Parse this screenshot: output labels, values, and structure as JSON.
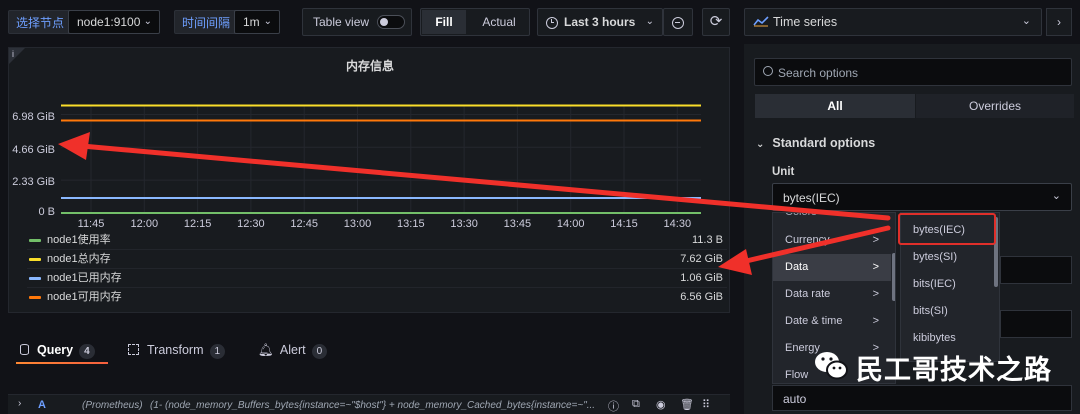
{
  "toolbar": {
    "node_label": "选择节点",
    "node_value": "node1:9100",
    "interval_label": "时间间隔",
    "interval_value": "1m",
    "table_view": "Table view",
    "fill": "Fill",
    "actual": "Actual",
    "time_range": "Last 3 hours"
  },
  "panel": {
    "title": "内存信息",
    "info_icon": "i",
    "legend": [
      {
        "name": "node1使用率",
        "value": "11.3 B",
        "color": "#73bf69"
      },
      {
        "name": "node1总内存",
        "value": "7.62 GiB",
        "color": "#fade2a"
      },
      {
        "name": "node1已用内存",
        "value": "1.06 GiB",
        "color": "#8ab8ff"
      },
      {
        "name": "node1可用内存",
        "value": "6.56 GiB",
        "color": "#ff780a"
      }
    ]
  },
  "chart_data": {
    "type": "line",
    "title": "内存信息",
    "y_ticks": [
      "6.98 GiB",
      "4.66 GiB",
      "2.33 GiB",
      "0 B"
    ],
    "y_tick_values": [
      6.98,
      4.66,
      2.33,
      0
    ],
    "x_ticks": [
      "11:45",
      "12:00",
      "12:15",
      "12:30",
      "12:45",
      "13:00",
      "13:15",
      "13:30",
      "13:45",
      "14:00",
      "14:15",
      "14:30"
    ],
    "ylim": [
      0,
      7.3
    ],
    "series": [
      {
        "name": "node1总内存",
        "values": [
          7.62,
          7.62
        ]
      },
      {
        "name": "node1可用内存",
        "values": [
          6.56,
          6.56
        ]
      },
      {
        "name": "node1已用内存",
        "values": [
          1.06,
          1.06
        ]
      },
      {
        "name": "node1使用率",
        "values": [
          0,
          0
        ]
      }
    ],
    "grid": true,
    "legend": "bottom"
  },
  "tabs": [
    {
      "label": "Query",
      "count": "4"
    },
    {
      "label": "Transform",
      "count": "1"
    },
    {
      "label": "Alert",
      "count": "0"
    }
  ],
  "query": {
    "letter": "A",
    "datasource": "(Prometheus)",
    "expr": "(1- (node_memory_Buffers_bytes{instance=~\"$host\"} + node_memory_Cached_bytes{instance=~\"..."
  },
  "side": {
    "viz": "Time series",
    "search_placeholder": "Search options",
    "seg_all": "All",
    "seg_overrides": "Overrides",
    "section": "Standard options",
    "unit_label": "Unit",
    "unit_value": "bytes(IEC)",
    "auto_value": "auto"
  },
  "unit_menu": {
    "categories": [
      "Currency",
      "Data",
      "Data rate",
      "Date & time",
      "Energy",
      "Flow"
    ],
    "data_units": [
      "bytes(IEC)",
      "bytes(SI)",
      "bits(IEC)",
      "bits(SI)",
      "kibibytes"
    ]
  },
  "watermark": "民工哥技术之路",
  "colors": {
    "accent": "#6e9fff",
    "arrow": "#f0302a",
    "highlight": "#e02f2a"
  }
}
